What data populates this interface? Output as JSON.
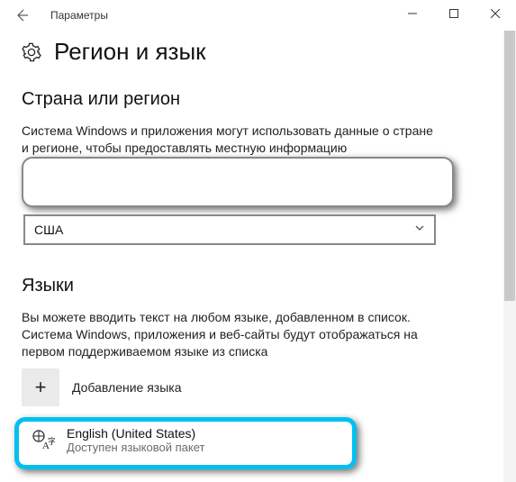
{
  "titlebar": {
    "title": "Параметры"
  },
  "header": {
    "title": "Регион и язык"
  },
  "region": {
    "heading": "Страна или регион",
    "desc": "Система Windows и приложения могут использовать данные о стране и регионе, чтобы предоставлять местную информацию",
    "selected": "США"
  },
  "languages": {
    "heading": "Языки",
    "desc": "Вы можете вводить текст на любом языке, добавленном в список. Система Windows, приложения и веб-сайты будут отображаться на первом поддерживаемом языке из списка",
    "add_label": "Добавление языка",
    "items": [
      {
        "name": "English (United States)",
        "sub": "Доступен языковой пакет"
      }
    ]
  }
}
